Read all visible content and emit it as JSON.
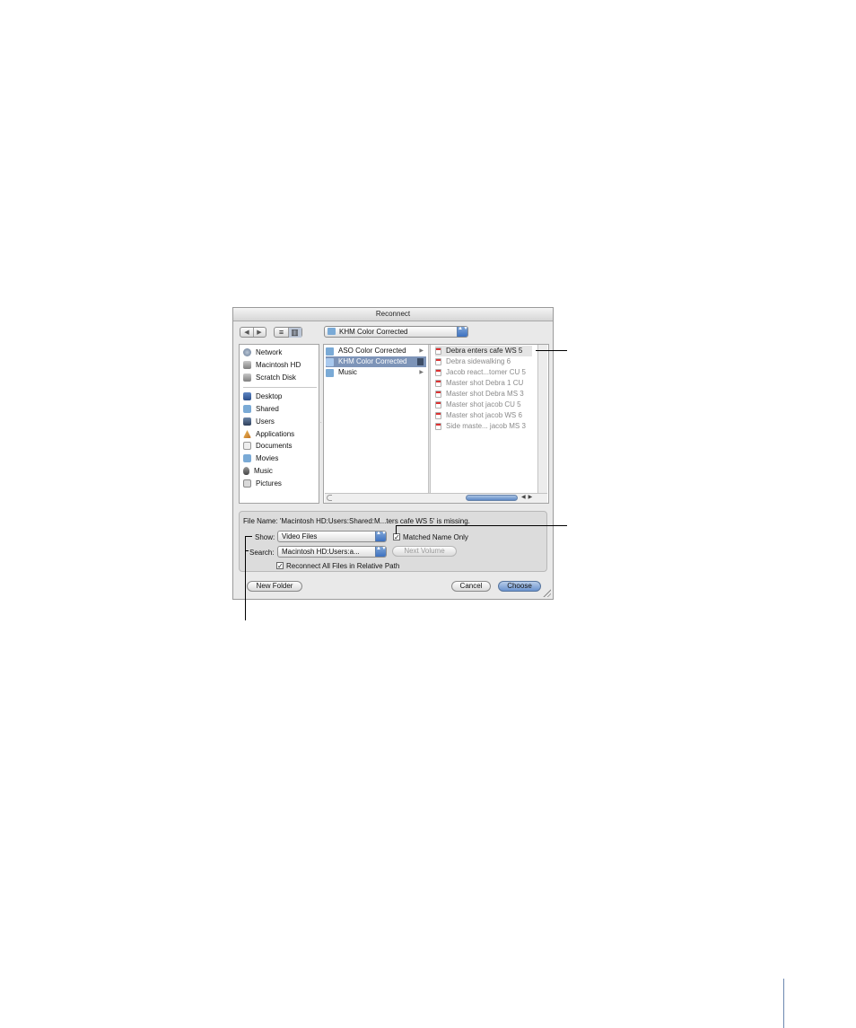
{
  "window": {
    "title": "Reconnect"
  },
  "toolbar": {
    "back_glyph": "◀",
    "forward_glyph": "▶",
    "list_view_glyph": "≡",
    "column_view_glyph": "▥",
    "location_popup": "KHM Color Corrected"
  },
  "sidebar": {
    "devices": [
      {
        "label": "Network",
        "icon": "network-icon"
      },
      {
        "label": "Macintosh HD",
        "icon": "hard-disk-icon"
      },
      {
        "label": "Scratch Disk",
        "icon": "hard-disk-icon"
      }
    ],
    "places": [
      {
        "label": "Desktop",
        "icon": "desktop-icon"
      },
      {
        "label": "Shared",
        "icon": "folder-icon"
      },
      {
        "label": "Users",
        "icon": "users-icon"
      },
      {
        "label": "Applications",
        "icon": "applications-icon"
      },
      {
        "label": "Documents",
        "icon": "documents-icon"
      },
      {
        "label": "Movies",
        "icon": "folder-icon"
      },
      {
        "label": "Music",
        "icon": "music-icon"
      },
      {
        "label": "Pictures",
        "icon": "pictures-icon"
      }
    ]
  },
  "browser": {
    "folders": [
      {
        "label": "ASO Color Corrected",
        "selected": false
      },
      {
        "label": "KHM Color Corrected",
        "selected": true
      },
      {
        "label": "Music",
        "selected": false
      }
    ],
    "files": [
      "Debra enters cafe WS 5",
      "Debra sidewalking 6",
      "Jacob react...tomer CU 5",
      "Master shot Debra 1 CU",
      "Master shot Debra MS 3",
      "Master shot jacob CU 5",
      "Master shot jacob WS 6",
      "Side maste... jacob MS 3"
    ]
  },
  "info": {
    "file_name_text": "File Name: 'Macintosh HD:Users:Shared:M...ters cafe WS 5' is missing.",
    "show_label": "Show:",
    "show_value": "Video Files",
    "matched_name_label": "Matched Name Only",
    "matched_name_checked": true,
    "search_label": "Search:",
    "search_value": "Macintosh HD:Users:a...",
    "next_volume_label": "Next Volume",
    "reconnect_all_label": "Reconnect All Files in Relative Path",
    "reconnect_all_checked": true
  },
  "buttons": {
    "new_folder": "New Folder",
    "cancel": "Cancel",
    "choose": "Choose"
  },
  "glyphs": {
    "check": "✓",
    "popup_arrows": "▲▼",
    "disclosure": "▶"
  },
  "colors": {
    "selection": "#7d94b8",
    "default_button": "#6a93cf",
    "page_rule": "#6d88b0"
  }
}
